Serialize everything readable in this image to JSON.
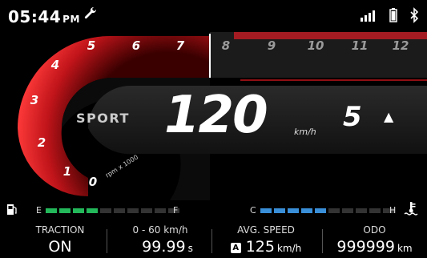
{
  "status": {
    "time": "05:44",
    "ampm": "PM"
  },
  "tach": {
    "ticks": [
      "0",
      "1",
      "2",
      "3",
      "4",
      "5",
      "6",
      "7",
      "8",
      "9",
      "10",
      "11",
      "12"
    ],
    "label": "rpm x 1000"
  },
  "ride": {
    "mode": "SPORT",
    "speed": "120",
    "speed_unit": "km/h",
    "gear": "5",
    "gear_arrow": "▲"
  },
  "fuel": {
    "empty_label": "E",
    "full_label": "F",
    "level_segments": 4,
    "total_segments": 10
  },
  "temp": {
    "cold_label": "C",
    "hot_label": "H",
    "level_segments": 5,
    "total_segments": 10
  },
  "info": {
    "traction_label": "TRACTION",
    "traction_value": "ON",
    "accel_label": "0 - 60 km/h",
    "accel_value": "99.99",
    "accel_unit": "s",
    "avg_label": "AVG. SPEED",
    "avg_badge": "A",
    "avg_value": "125",
    "avg_unit": "km/h",
    "odo_label": "ODO",
    "odo_value": "999999",
    "odo_unit": "km"
  },
  "colors": {
    "accent_red": "#e3242b",
    "fuel_green": "#23b85a",
    "temp_blue": "#3a8fd9"
  }
}
